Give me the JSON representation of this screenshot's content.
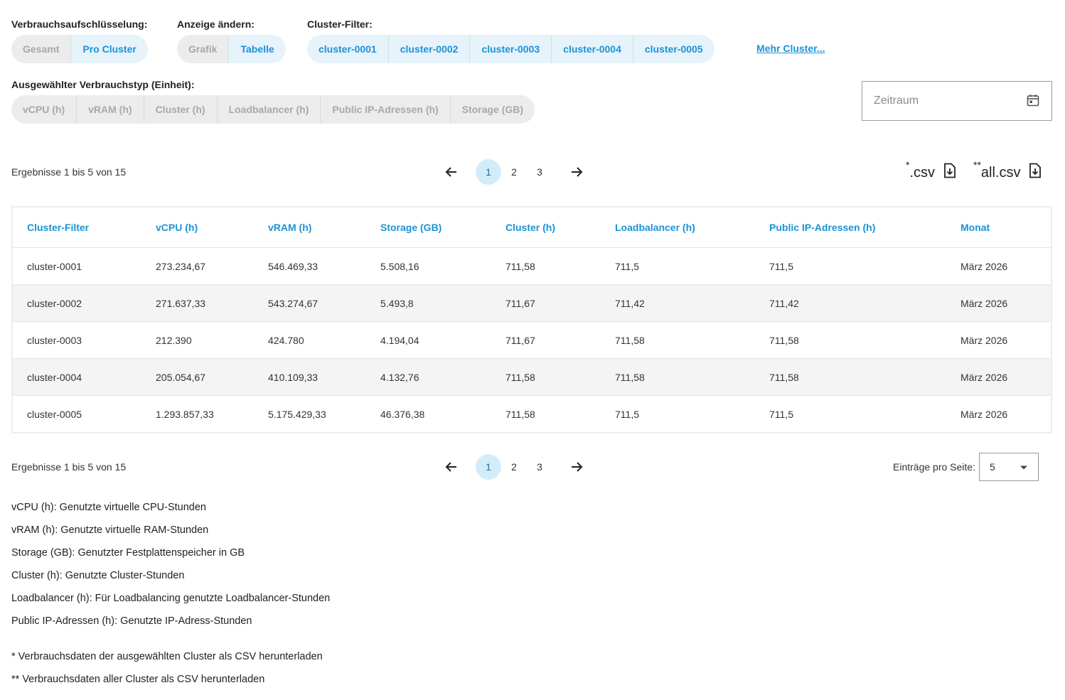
{
  "filters": {
    "breakdown": {
      "label": "Verbrauchsaufschlüsselung:",
      "options": [
        "Gesamt",
        "Pro Cluster"
      ],
      "selected": "Pro Cluster"
    },
    "display": {
      "label": "Anzeige ändern:",
      "options": [
        "Grafik",
        "Tabelle"
      ],
      "selected": "Tabelle"
    },
    "cluster": {
      "label": "Cluster-Filter:",
      "options": [
        "cluster-0001",
        "cluster-0002",
        "cluster-0003",
        "cluster-0004",
        "cluster-0005"
      ],
      "more_link": "Mehr Cluster..."
    },
    "usage_type": {
      "label": "Ausgewählter Verbrauchstyp (Einheit):",
      "options": [
        "vCPU (h)",
        "vRAM (h)",
        "Cluster (h)",
        "Loadbalancer (h)",
        "Public IP-Adressen (h)",
        "Storage (GB)"
      ]
    },
    "period": {
      "placeholder": "Zeitraum",
      "icon": "calendar-icon"
    }
  },
  "results_text": "Ergebnisse 1 bis 5 von 15",
  "pagination": {
    "pages": [
      "1",
      "2",
      "3"
    ],
    "current": "1"
  },
  "downloads": {
    "selected": {
      "prefix": "*",
      "label": ".csv",
      "icon": "file-download-icon"
    },
    "all": {
      "prefix": "**",
      "label": "all.csv",
      "icon": "file-download-icon"
    }
  },
  "table": {
    "headers": [
      "Cluster-Filter",
      "vCPU (h)",
      "vRAM (h)",
      "Storage (GB)",
      "Cluster (h)",
      "Loadbalancer (h)",
      "Public IP-Adressen (h)",
      "Monat"
    ],
    "rows": [
      [
        "cluster-0001",
        "273.234,67",
        "546.469,33",
        "5.508,16",
        "711,58",
        "711,5",
        "711,5",
        "März 2026"
      ],
      [
        "cluster-0002",
        "271.637,33",
        "543.274,67",
        "5.493,8",
        "711,67",
        "711,42",
        "711,42",
        "März 2026"
      ],
      [
        "cluster-0003",
        "212.390",
        "424.780",
        "4.194,04",
        "711,67",
        "711,58",
        "711,58",
        "März 2026"
      ],
      [
        "cluster-0004",
        "205.054,67",
        "410.109,33",
        "4.132,76",
        "711,58",
        "711,58",
        "711,58",
        "März 2026"
      ],
      [
        "cluster-0005",
        "1.293.857,33",
        "5.175.429,33",
        "46.376,38",
        "711,58",
        "711,5",
        "711,5",
        "März 2026"
      ]
    ]
  },
  "per_page": {
    "label": "Einträge pro Seite:",
    "value": "5"
  },
  "legend": [
    "vCPU (h): Genutzte virtuelle CPU-Stunden",
    "vRAM (h): Genutzte virtuelle RAM-Stunden",
    "Storage (GB): Genutzter Festplattenspeicher in GB",
    "Cluster (h): Genutzte Cluster-Stunden",
    "Loadbalancer (h): Für Loadbalancing genutzte Loadbalancer-Stunden",
    "Public IP-Adressen (h): Genutzte IP-Adress-Stunden"
  ],
  "footnotes": [
    "* Verbrauchsdaten der ausgewählten Cluster als CSV herunterladen",
    "** Verbrauchsdaten aller Cluster als CSV herunterladen"
  ],
  "colors": {
    "accent": "#1a93d6",
    "active_bg": "#e6f3fb",
    "inactive_bg": "#ececec",
    "page_active_bg": "#d4ecfa"
  }
}
